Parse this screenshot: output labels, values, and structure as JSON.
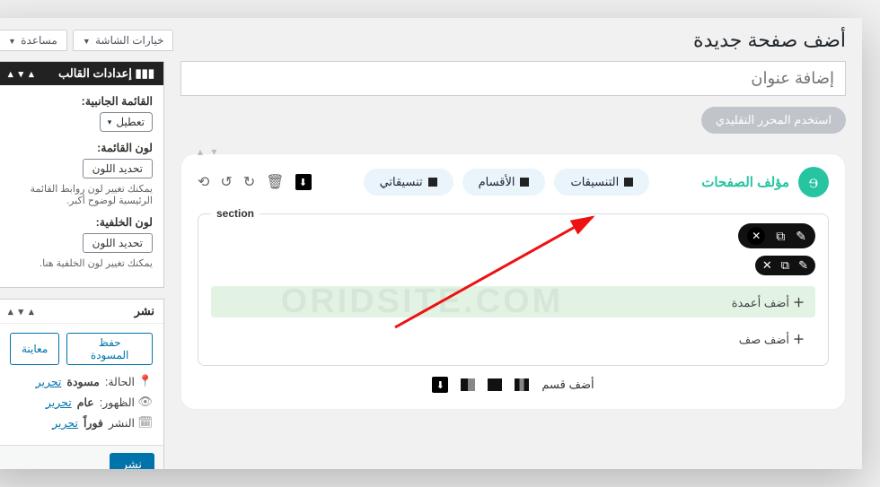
{
  "top": {
    "pageTitle": "أضف صفحة جديدة",
    "screenOptions": "خيارات الشاشة",
    "help": "مساعدة"
  },
  "title": {
    "placeholder": "إضافة عنوان"
  },
  "classicBtn": "استخدم المحرر التقليدي",
  "themeBox": {
    "heading": "إعدادات القالب",
    "sidebarLabel": "القائمة الجانبية:",
    "sidebarSelect": "تعطيل",
    "menuColorLabel": "لون القائمة:",
    "colorBtn": "تحديد اللون",
    "menuHint": "يمكنك تغيير لون روابط القائمة الرئيسية لوضوح أكبر.",
    "bgLabel": "لون الخلفية:",
    "bgHint": "يمكنك تغيير لون الخلفية هنا."
  },
  "publishBox": {
    "heading": "نشر",
    "saveDraft": "حفظ المسودة",
    "preview": "معاينة",
    "status": "الحالة:",
    "statusVal": "مسودة",
    "statusEdit": "تحرير",
    "visibility": "الظهور:",
    "visibilityVal": "عام",
    "visibilityEdit": "تحرير",
    "schedule": "النشر",
    "scheduleVal": "فوراً",
    "scheduleEdit": "تحرير",
    "publishBtn": "نشر"
  },
  "composer": {
    "brand": "مؤلف الصفحات",
    "pills": {
      "layouts": "التنسيقات",
      "sections": "الأقسام",
      "myLayouts": "تنسيقاتي"
    },
    "sectionLabel": "section",
    "addCols": "أضف أعمدة",
    "addRow": "أضف صف",
    "addSection": "أضف قسم"
  },
  "watermark": "ORIDSITE.COM"
}
